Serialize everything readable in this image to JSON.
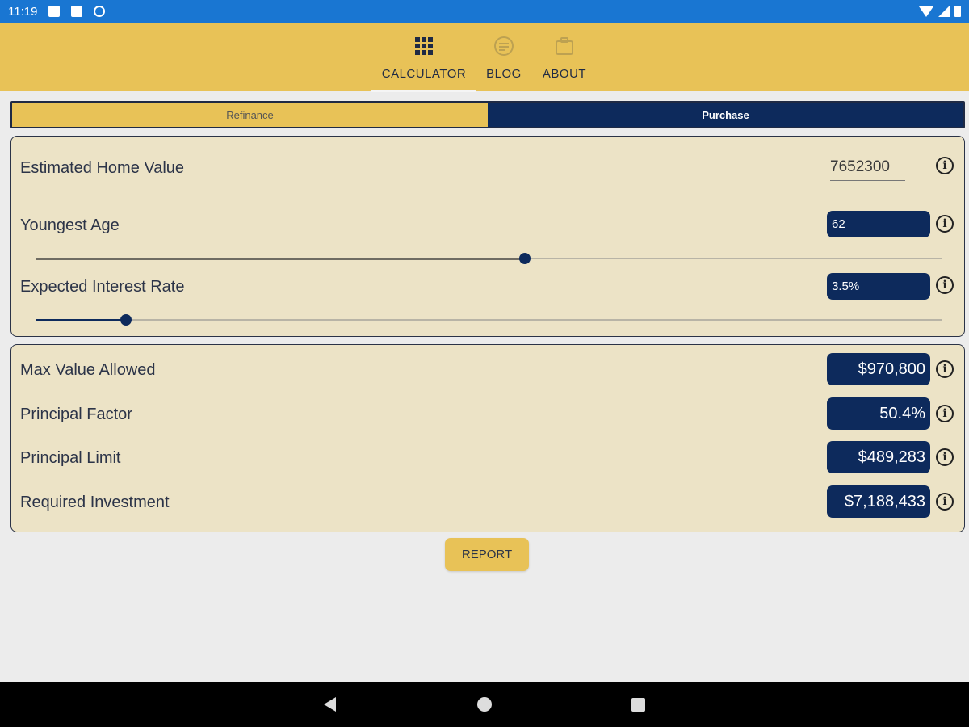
{
  "status_bar": {
    "time": "11:19"
  },
  "tabs": [
    {
      "label": "CALCULATOR",
      "icon": "grid-icon",
      "active": true
    },
    {
      "label": "BLOG",
      "icon": "news-icon",
      "active": false
    },
    {
      "label": "ABOUT",
      "icon": "briefcase-icon",
      "active": false
    }
  ],
  "segment": {
    "refinance": "Refinance",
    "purchase": "Purchase",
    "selected": "Purchase"
  },
  "inputs": {
    "home_value": {
      "label": "Estimated Home Value",
      "value": "7652300"
    },
    "youngest_age": {
      "label": "Youngest Age",
      "value": "62",
      "slider_fraction": 0.54
    },
    "interest_rate": {
      "label": "Expected Interest Rate",
      "value": "3.5%",
      "slider_fraction": 0.1
    }
  },
  "results": {
    "max_value": {
      "label": "Max Value Allowed",
      "value": "$970,800"
    },
    "principal_factor": {
      "label": "Principal Factor",
      "value": "50.4%"
    },
    "principal_limit": {
      "label": "Principal Limit",
      "value": "$489,283"
    },
    "required_investment": {
      "label": "Required Investment",
      "value": "$7,188,433"
    }
  },
  "report_button": "REPORT",
  "info_glyph": "i",
  "colors": {
    "status_bar": "#1976d2",
    "accent": "#e8c257",
    "navy": "#0d2a5c",
    "card": "#ece3c6"
  }
}
